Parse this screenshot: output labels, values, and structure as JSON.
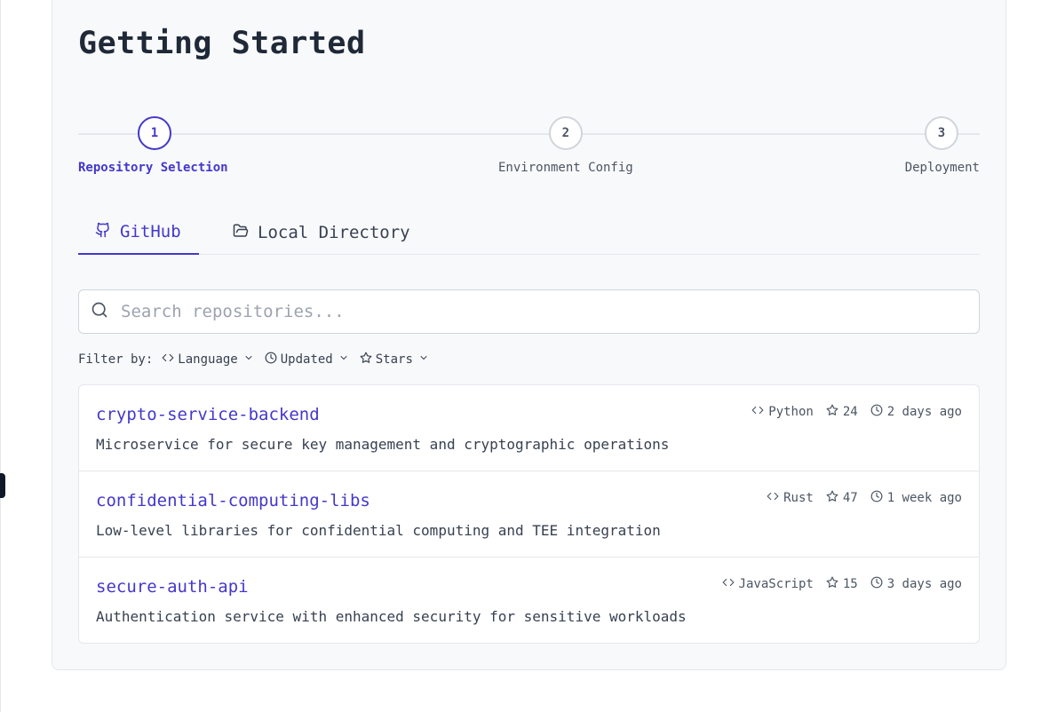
{
  "page": {
    "title": "Getting Started"
  },
  "stepper": {
    "steps": [
      {
        "number": "1",
        "label": "Repository Selection",
        "active": true
      },
      {
        "number": "2",
        "label": "Environment Config",
        "active": false
      },
      {
        "number": "3",
        "label": "Deployment",
        "active": false
      }
    ]
  },
  "tabs": [
    {
      "label": "GitHub",
      "icon": "github-icon",
      "active": true
    },
    {
      "label": "Local Directory",
      "icon": "folder-open-icon",
      "active": false
    }
  ],
  "search": {
    "placeholder": "Search repositories...",
    "value": ""
  },
  "filters": {
    "label": "Filter by:",
    "items": [
      {
        "label": "Language",
        "icon": "code-icon"
      },
      {
        "label": "Updated",
        "icon": "clock-icon"
      },
      {
        "label": "Stars",
        "icon": "star-icon"
      }
    ]
  },
  "repos": [
    {
      "name": "crypto-service-backend",
      "description": "Microservice for secure key management and cryptographic operations",
      "language": "Python",
      "stars": "24",
      "updated": "2 days ago"
    },
    {
      "name": "confidential-computing-libs",
      "description": "Low-level libraries for confidential computing and TEE integration",
      "language": "Rust",
      "stars": "47",
      "updated": "1 week ago"
    },
    {
      "name": "secure-auth-api",
      "description": "Authentication service with enhanced security for sensitive workloads",
      "language": "JavaScript",
      "stars": "15",
      "updated": "3 days ago"
    }
  ],
  "colors": {
    "accent": "#4338ca",
    "border": "#e5e7eb",
    "card_bg": "#f8f9fb"
  }
}
